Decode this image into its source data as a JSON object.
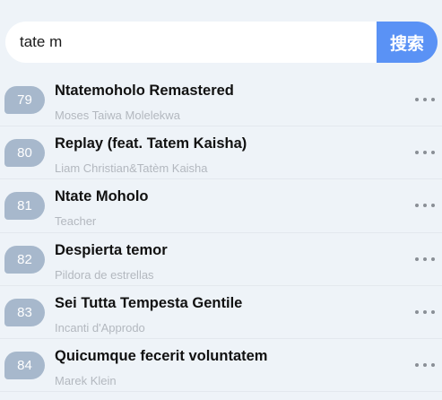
{
  "search": {
    "query": "tate m",
    "button_label": "搜索"
  },
  "results": [
    {
      "rank": "79",
      "title": "Ntatemoholo Remastered",
      "artist": "Moses Taiwa Molelekwa"
    },
    {
      "rank": "80",
      "title": "Replay (feat. Tatem Kaisha)",
      "artist": "Liam Christian&Tatèm Kaisha"
    },
    {
      "rank": "81",
      "title": "Ntate Moholo",
      "artist": "Teacher"
    },
    {
      "rank": "82",
      "title": "Despierta temor",
      "artist": "Pildora de estrellas"
    },
    {
      "rank": "83",
      "title": "Sei Tutta Tempesta Gentile",
      "artist": "Incanti d'Approdo"
    },
    {
      "rank": "84",
      "title": "Quicumque fecerit voluntatem",
      "artist": "Marek Klein"
    }
  ],
  "icons": {
    "more": "more-dots-icon"
  },
  "colors": {
    "background": "#eef3f8",
    "accent": "#5a92f5",
    "badge": "#a7b8cc",
    "secondary_text": "#b3b8bf"
  }
}
